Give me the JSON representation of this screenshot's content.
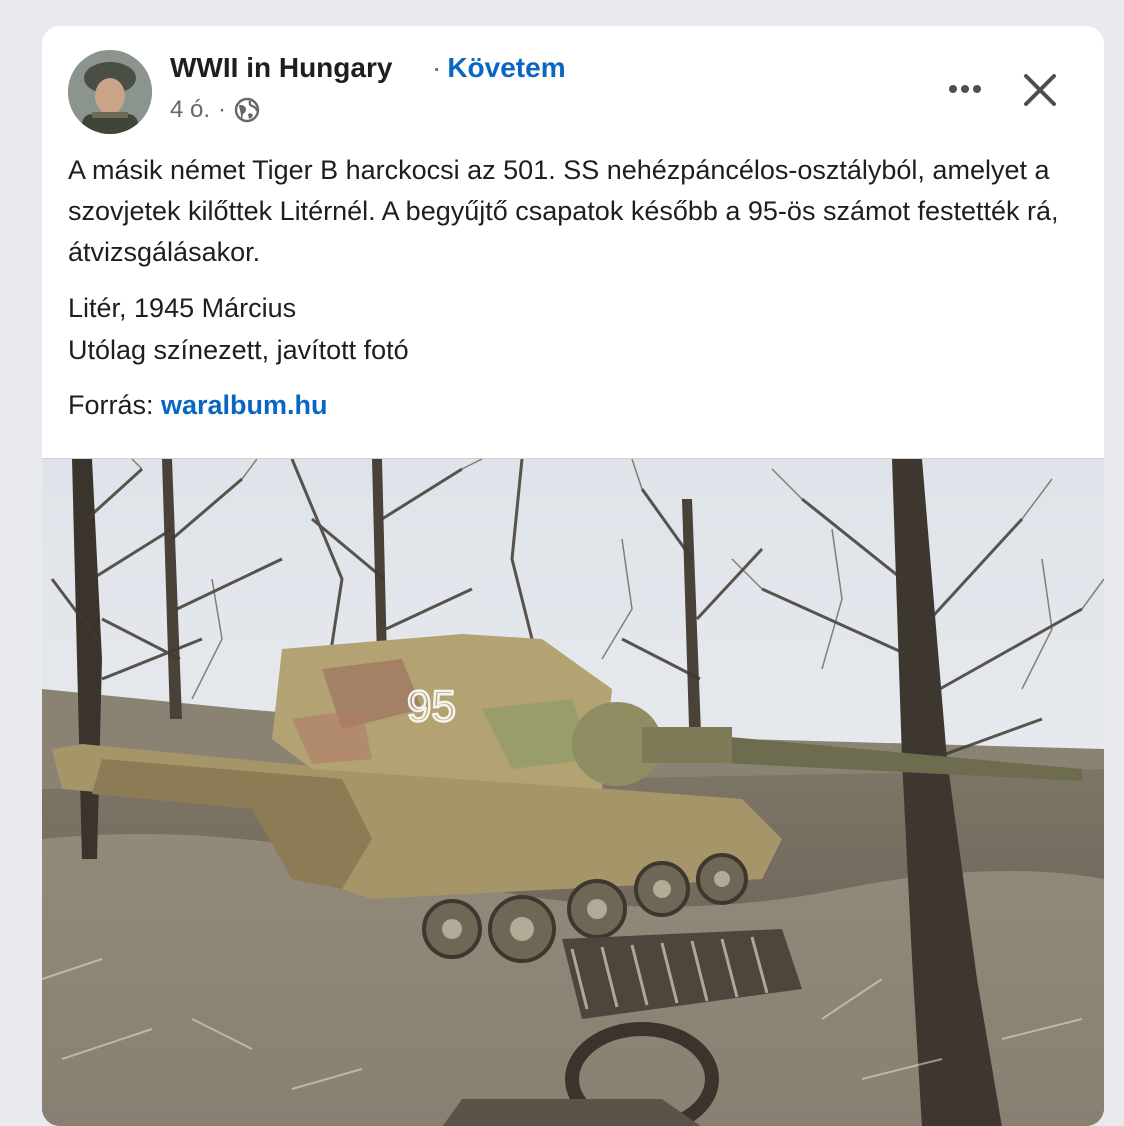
{
  "post": {
    "page_name": "WWII in Hungary",
    "separator": "·",
    "follow_label": "Követem",
    "time": "4 ó.",
    "meta_separator": "·",
    "privacy_icon": "globe-icon",
    "more_icon": "more-options-icon",
    "close_icon": "close-icon",
    "text": {
      "paragraph1": "A másik német Tiger B harckocsi az 501. SS nehézpáncélos-osztályból, amelyet a szovjetek kilőttek Litérnél. A begyűjtő csapatok később a 95-ös számot festették rá, átvizsgálásakor.",
      "location_line": "Litér, 1945 Március",
      "note_line": "Utólag színezett, javított fotó",
      "source_label": "Forrás: ",
      "source_link": "waralbum.hu"
    },
    "photo": {
      "tank_number": "95"
    }
  },
  "colors": {
    "link": "#0a66c2",
    "text": "#1c1e21",
    "secondary": "#65676b",
    "card": "#ffffff",
    "page_bg": "#e9eaee"
  }
}
